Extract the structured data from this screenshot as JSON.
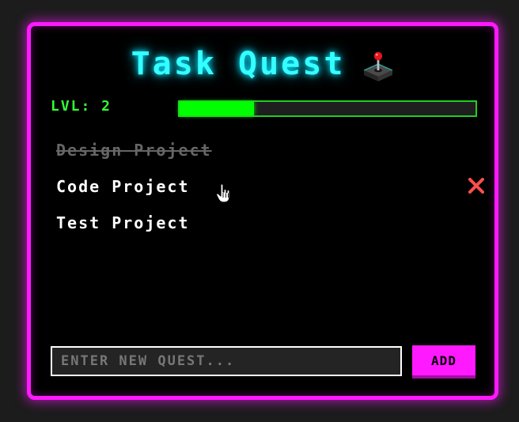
{
  "app": {
    "title": "Task Quest",
    "title_icon": "joystick-icon"
  },
  "level": {
    "label": "LVL: 2",
    "xp_progress": 0.25
  },
  "tasks": [
    {
      "label": "Design Project",
      "completed": true
    },
    {
      "label": "Code Project",
      "completed": false,
      "hovered": true,
      "delete_icon": "close-icon"
    },
    {
      "label": "Test Project",
      "completed": false
    }
  ],
  "input": {
    "value": "",
    "placeholder": "ENTER NEW QUEST..."
  },
  "add_button": {
    "label": "ADD"
  },
  "colors": {
    "background": "#1c1c1c",
    "panel": "#000000",
    "panel_border": "#ff19ff",
    "title": "#35ffff",
    "level_text": "#33ff33",
    "xp_fill": "#00ff00",
    "task_text": "#ffffff",
    "task_done": "#666666",
    "delete": "#ff4d4d",
    "button": "#ff19ff"
  }
}
